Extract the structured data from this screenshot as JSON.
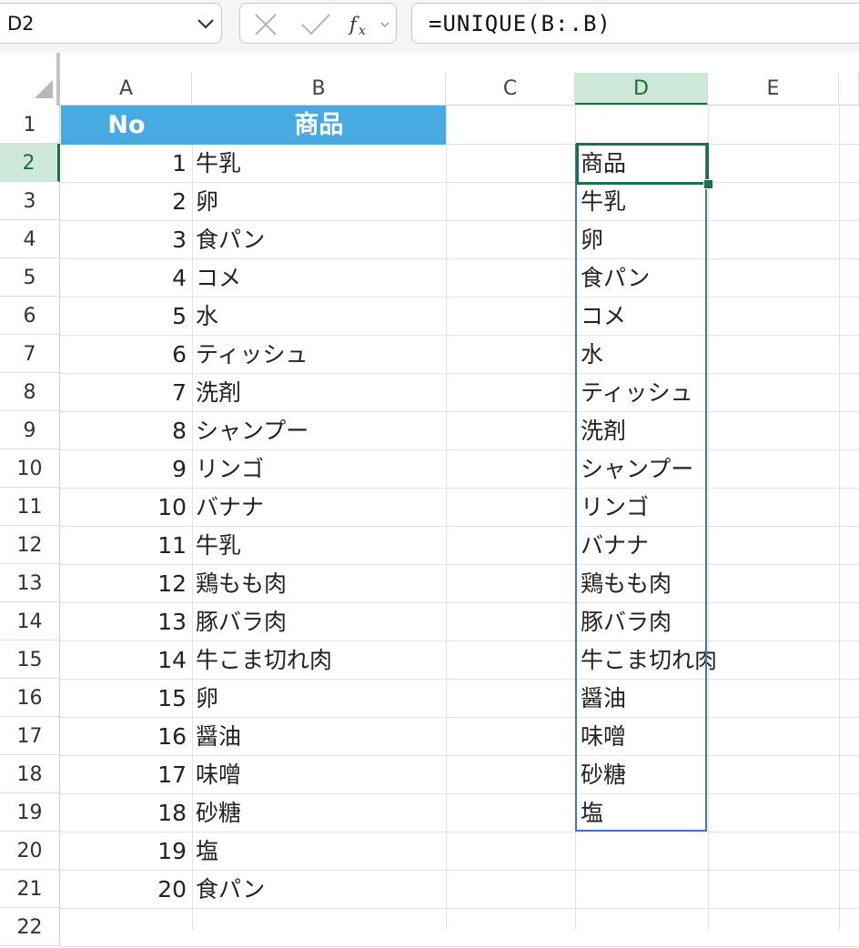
{
  "formula_bar": {
    "name_box": "D2",
    "formula": "=UNIQUE(B:.B)",
    "icons": [
      "chevron-down-icon",
      "cancel-x-icon",
      "confirm-check-icon",
      "fx-icon"
    ]
  },
  "columns": [
    "A",
    "B",
    "C",
    "D",
    "E"
  ],
  "selected_column": "D",
  "rows": [
    "1",
    "2",
    "3",
    "4",
    "5",
    "6",
    "7",
    "8",
    "9",
    "10",
    "11",
    "12",
    "13",
    "14",
    "15",
    "16",
    "17",
    "18",
    "19",
    "20",
    "21",
    "22"
  ],
  "selected_row": "2",
  "header_row": {
    "a": "No",
    "b": "商品"
  },
  "table": [
    {
      "no": "1",
      "item": "牛乳"
    },
    {
      "no": "2",
      "item": "卵"
    },
    {
      "no": "3",
      "item": "食パン"
    },
    {
      "no": "4",
      "item": "コメ"
    },
    {
      "no": "5",
      "item": "水"
    },
    {
      "no": "6",
      "item": "ティッシュ"
    },
    {
      "no": "7",
      "item": "洗剤"
    },
    {
      "no": "8",
      "item": "シャンプー"
    },
    {
      "no": "9",
      "item": "リンゴ"
    },
    {
      "no": "10",
      "item": "バナナ"
    },
    {
      "no": "11",
      "item": "牛乳"
    },
    {
      "no": "12",
      "item": "鶏もも肉"
    },
    {
      "no": "13",
      "item": "豚バラ肉"
    },
    {
      "no": "14",
      "item": "牛こま切れ肉"
    },
    {
      "no": "15",
      "item": "卵"
    },
    {
      "no": "16",
      "item": "醤油"
    },
    {
      "no": "17",
      "item": "味噌"
    },
    {
      "no": "18",
      "item": "砂糖"
    },
    {
      "no": "19",
      "item": "塩"
    },
    {
      "no": "20",
      "item": "食パン"
    }
  ],
  "unique_result": [
    "商品",
    "牛乳",
    "卵",
    "食パン",
    "コメ",
    "水",
    "ティッシュ",
    "洗剤",
    "シャンプー",
    "リンゴ",
    "バナナ",
    "鶏もも肉",
    "豚バラ肉",
    "牛こま切れ肉",
    "醤油",
    "味噌",
    "砂糖",
    "塩"
  ],
  "colors": {
    "header_fill": "#47abe2",
    "selection_green": "#1e7145",
    "spill_border": "#4472c4",
    "selected_header_bg": "#cde8d9"
  }
}
